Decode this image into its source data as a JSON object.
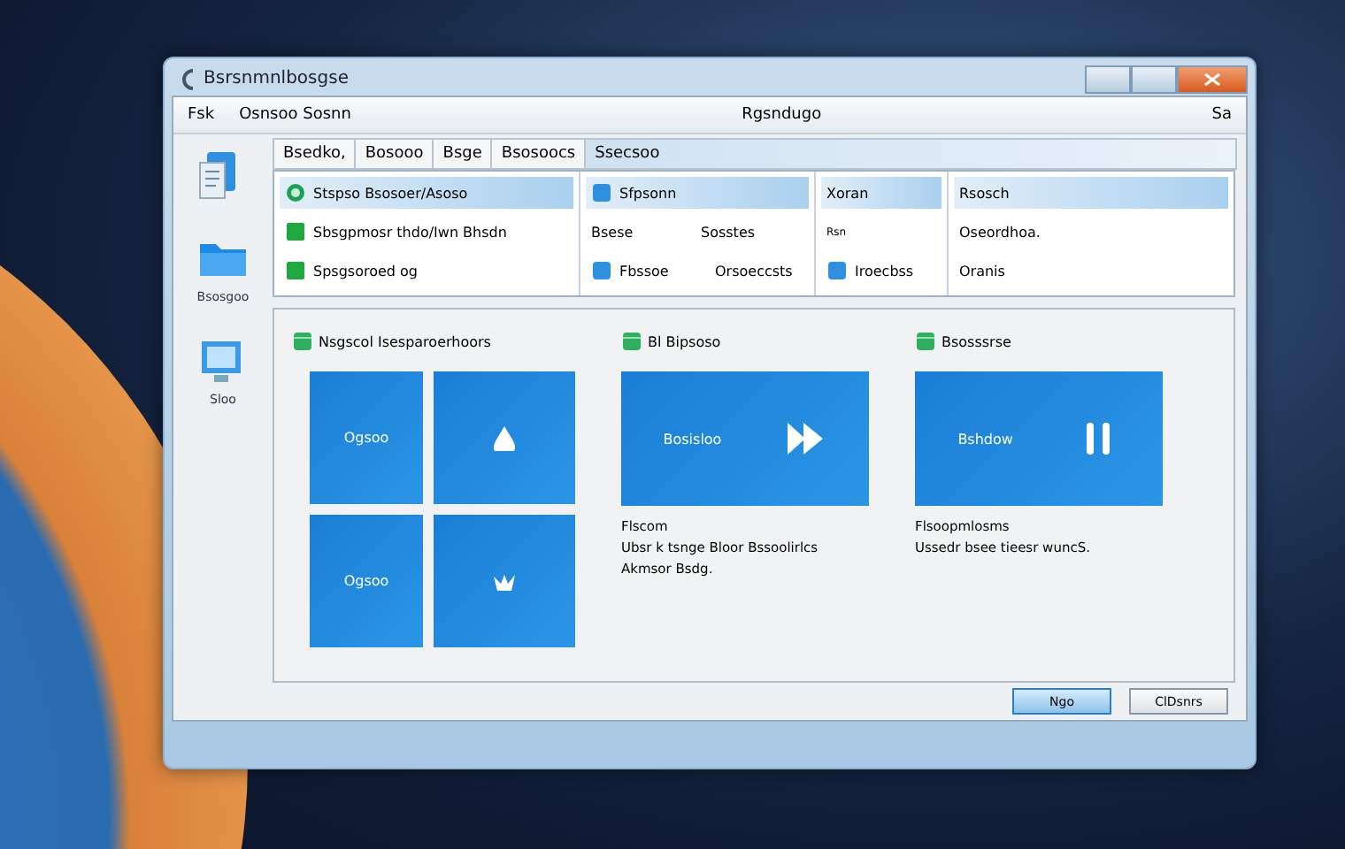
{
  "window": {
    "title": "Bsrsnmnlbosgse"
  },
  "menu": {
    "left": [
      "Fsk",
      "Osnsoo Sosnn"
    ],
    "center": "Rgsndugo",
    "right": "Sa"
  },
  "sidebar": {
    "items": [
      {
        "kind": "icon-only"
      },
      {
        "kind": "labeled",
        "label": "Bsosgoo"
      },
      {
        "kind": "labeled",
        "label": "Sloo"
      }
    ]
  },
  "tabs": [
    {
      "label": "Bsedko,",
      "selected": false
    },
    {
      "label": "Bosooo",
      "selected": false
    },
    {
      "label": "Bsge",
      "selected": false
    },
    {
      "label": "Bsosoocs",
      "selected": false
    },
    {
      "label": "Ssecsoo",
      "selected": true
    }
  ],
  "grid": {
    "columns": [
      {
        "items": [
          {
            "kind": "icon",
            "text": "Stspso Bsosoer/Asoso",
            "selected": true
          },
          {
            "kind": "icon",
            "text": "Sbsgpmosr thdo/Iwn Bhsdn",
            "selected": false
          },
          {
            "kind": "icon",
            "text": "Spsgsoroed og",
            "selected": false
          }
        ]
      },
      {
        "items": [
          {
            "kind": "icon",
            "text": "Sfpsonn",
            "selected": true
          },
          {
            "kind": "pair",
            "cells": [
              "Bsese",
              "Sosstes"
            ],
            "selected": false
          },
          {
            "kind": "icon-pair",
            "cells": [
              "Fbssoe",
              "Orsoeccsts"
            ],
            "selected": false
          }
        ]
      },
      {
        "items": [
          {
            "kind": "plain",
            "text": "Xoran",
            "selected": true
          },
          {
            "kind": "small",
            "text": "Rsn",
            "selected": false
          },
          {
            "kind": "icon",
            "text": "Iroecbss",
            "selected": false
          }
        ]
      },
      {
        "items": [
          {
            "kind": "plain",
            "text": "Rsosch",
            "selected": true
          },
          {
            "kind": "plain",
            "text": "Oseordhoa.",
            "selected": false
          },
          {
            "kind": "plain",
            "text": "Oranis",
            "selected": false
          }
        ]
      }
    ]
  },
  "groups": [
    {
      "title": "Nsgscol Isesparoerhoors",
      "kind": "tiles",
      "tiles": [
        {
          "kind": "text",
          "label": "Ogsoo"
        },
        {
          "kind": "glyph"
        },
        {
          "kind": "text",
          "label": "Ogsoo"
        },
        {
          "kind": "glyph"
        }
      ]
    },
    {
      "title": "Bl Bipsoso",
      "kind": "media",
      "tile": {
        "label": "Bosisloo"
      },
      "caption": [
        "Flscom",
        "Ubsr k tsnge Bloor Bssoolirlcs",
        "Akmsor Bsdg."
      ]
    },
    {
      "title": "Bsosssrse",
      "kind": "media",
      "tile": {
        "label": "Bshdow"
      },
      "caption": [
        "Flsoopmlosms",
        "Ussedr bsee tieesr wuncS."
      ]
    }
  ],
  "buttons": [
    {
      "label": "Ngo",
      "default": true
    },
    {
      "label": "ClDsnrs",
      "default": false
    }
  ]
}
